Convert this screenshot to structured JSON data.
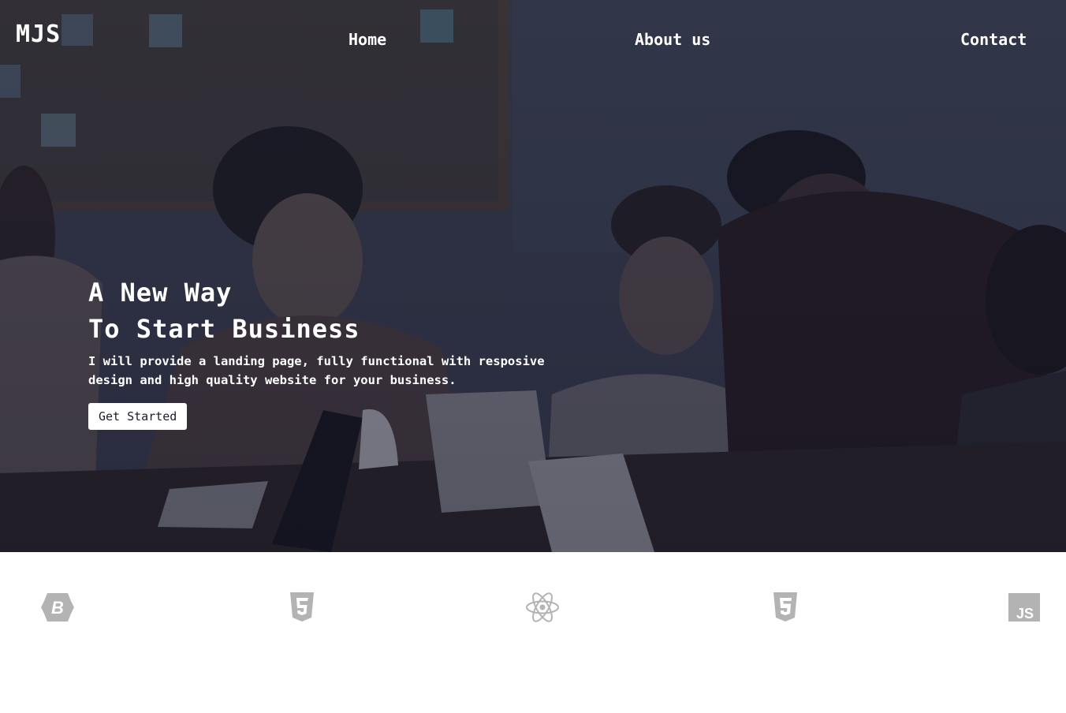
{
  "brand": "MJS",
  "nav": {
    "home": "Home",
    "about": "About us",
    "contact": "Contact"
  },
  "hero": {
    "title_line1": "A New Way",
    "title_line2": "To Start Business",
    "description": "I will provide a landing page, fully functional with resposive design and high quality website for your business.",
    "cta_label": "Get Started"
  },
  "tech_icons": [
    "bootstrap-icon",
    "html5-icon",
    "react-icon",
    "css3-icon",
    "javascript-icon"
  ],
  "colors": {
    "hero_overlay": "#2a2e40",
    "icon_gray": "#b3b3b3",
    "text_light": "#ffffff"
  }
}
